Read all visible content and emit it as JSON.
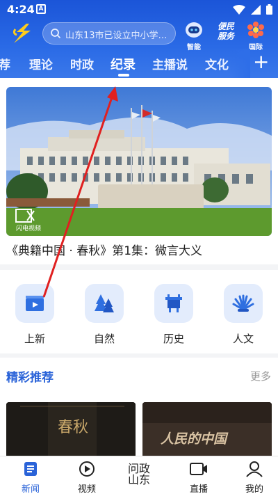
{
  "status_bar": {
    "time": "4:24",
    "notification": "A"
  },
  "header": {
    "search_placeholder": "山东13市已设立中小学…",
    "buttons": [
      {
        "label": "智能",
        "icon": "robot-icon"
      },
      {
        "label": "",
        "icon": "bianmin-service-icon",
        "badge_text": "便民服务"
      },
      {
        "label": "国际",
        "icon": "globe-flower-icon"
      }
    ]
  },
  "tabs": [
    {
      "label": "荐"
    },
    {
      "label": "理论"
    },
    {
      "label": "时政"
    },
    {
      "label": "纪录",
      "active": true
    },
    {
      "label": "主播说"
    },
    {
      "label": "文化"
    },
    {
      "label": "+"
    }
  ],
  "hero": {
    "caption": "《典籍中国 · 春秋》第1集：微言大义",
    "watermark": "闪电视频"
  },
  "categories": [
    {
      "label": "上新",
      "icon": "video-clapper-icon"
    },
    {
      "label": "自然",
      "icon": "trees-icon"
    },
    {
      "label": "历史",
      "icon": "bronze-ding-icon"
    },
    {
      "label": "人文",
      "icon": "shell-fan-icon"
    }
  ],
  "section": {
    "title": "精彩推荐",
    "more": "更多"
  },
  "thumbnails": [
    {
      "title_art": "春秋"
    },
    {
      "title_art": "人民的中国"
    }
  ],
  "bottom_nav": [
    {
      "label": "新闻",
      "icon": "news-icon",
      "active": true
    },
    {
      "label": "视频",
      "icon": "play-circle-icon"
    },
    {
      "label": "",
      "icon": "wenzheng-shandong-icon",
      "text_art": "问政山东"
    },
    {
      "label": "直播",
      "icon": "live-camera-icon"
    },
    {
      "label": "我的",
      "icon": "person-icon"
    }
  ],
  "colors": {
    "primary_blue": "#2a63d8",
    "header_blue": "#1b55d8",
    "annotation_red": "#e02020"
  }
}
